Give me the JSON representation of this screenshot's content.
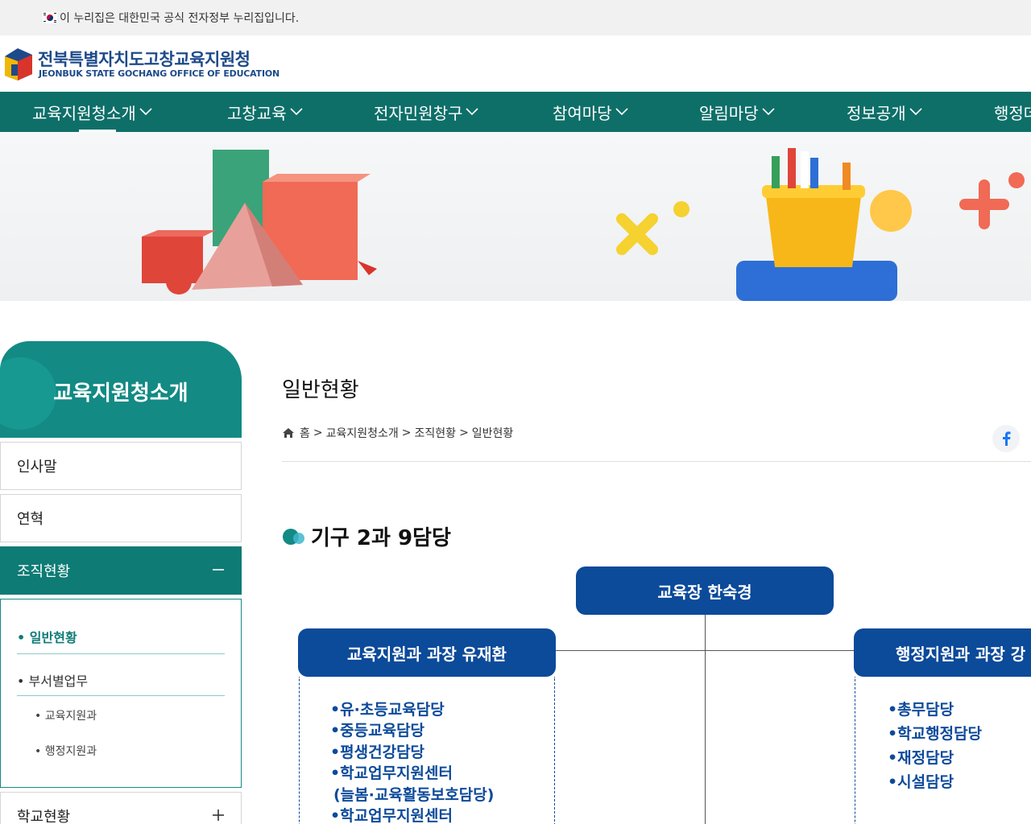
{
  "gov_bar": {
    "text": "이 누리집은 대한민국 공식 전자정부 누리집입니다."
  },
  "header": {
    "title": "전북특별자치도고창교육지원청",
    "subtitle": "JEONBUK STATE GOCHANG OFFICE OF EDUCATION"
  },
  "gnb": {
    "items": [
      {
        "label": "교육지원청소개"
      },
      {
        "label": "고창교육"
      },
      {
        "label": "전자민원창구"
      },
      {
        "label": "참여마당"
      },
      {
        "label": "알림마당"
      },
      {
        "label": "정보공개"
      },
      {
        "label": "행정데"
      }
    ]
  },
  "sidebar": {
    "title": "교육지원청소개",
    "items": [
      {
        "label": "인사말"
      },
      {
        "label": "연혁"
      },
      {
        "label": "조직현황"
      },
      {
        "label": "학교현황"
      }
    ],
    "sub_items": [
      {
        "label": "• 일반현황"
      },
      {
        "label": "• 부서별업무"
      }
    ],
    "sub_sub_items": [
      {
        "label": "• 교육지원과"
      },
      {
        "label": "• 행정지원과"
      }
    ]
  },
  "content": {
    "page_title": "일반현황",
    "breadcrumb": [
      "홈",
      ">",
      "교육지원청소개",
      ">",
      "조직현황",
      ">",
      "일반현황"
    ],
    "section_title": "기구 2과 9담당"
  },
  "org_chart": {
    "head": "교육장 한숙경",
    "left_dept": "교육지원과 과장 유재환",
    "right_dept": "행정지원과 과장 강",
    "left_units": [
      "•유·초등교육담당",
      "•중등교육담당",
      "•평생건강담당",
      "•학교업무지원센터",
      " (늘봄·교육활동보호담당)",
      "•학교업무지원센터"
    ],
    "right_units": [
      "•총무담당",
      "•학교행정담당",
      "•재정담당",
      "•시설담당"
    ]
  },
  "colors": {
    "gnb_bg": "#0e6f69",
    "side_accent": "#138a84",
    "org_blue": "#0c4a9a"
  }
}
